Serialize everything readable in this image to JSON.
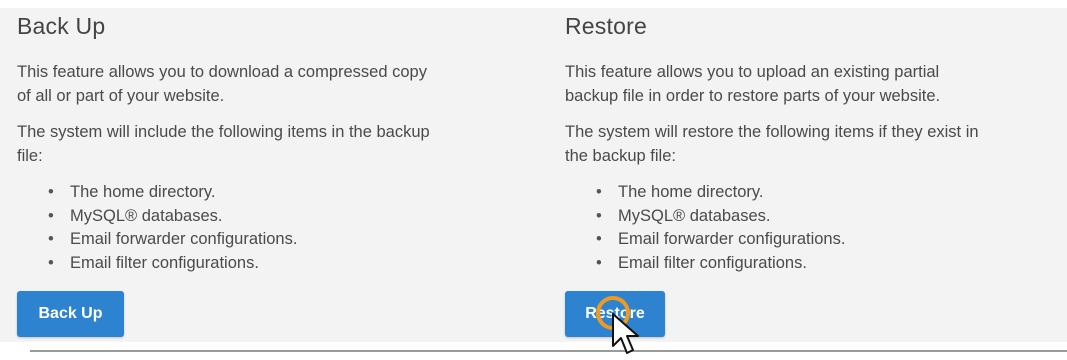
{
  "backup": {
    "title": "Back Up",
    "paragraph1_line1": "This feature allows you to download a compressed copy",
    "paragraph1_line2": "of all or part of your website.",
    "paragraph2_line1": "The system will include the following items in the backup",
    "paragraph2_line2": "file:",
    "items": [
      "The home directory.",
      "MySQL® databases.",
      "Email forwarder configurations.",
      "Email filter configurations."
    ],
    "button_label": "Back Up"
  },
  "restore": {
    "title": "Restore",
    "paragraph1_line1": "This feature allows you to upload an existing partial",
    "paragraph1_line2": "backup file in order to restore parts of your website.",
    "paragraph2_line1": "The system will restore the following items if they exist in",
    "paragraph2_line2": "the backup file:",
    "items": [
      "The home directory.",
      "MySQL® databases.",
      "Email forwarder configurations.",
      "Email filter configurations."
    ],
    "button_label": "Restore"
  },
  "colors": {
    "button": "#2d83cf",
    "panel": "#f3f3f3",
    "click_highlight": "#f19a1e"
  },
  "icons": {
    "cursor": "arrow-cursor-icon",
    "click_highlight": "click-ring-icon"
  }
}
